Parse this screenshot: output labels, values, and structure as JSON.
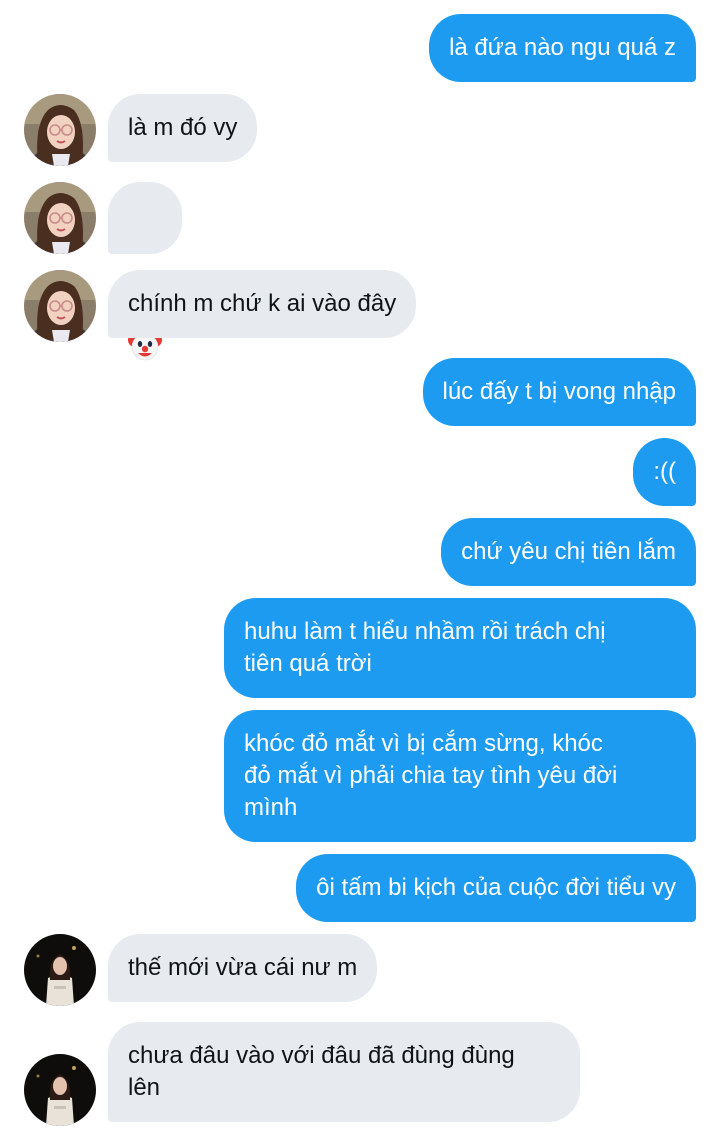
{
  "colors": {
    "outgoing_bubble": "#1d9bf0",
    "incoming_bubble": "#e7ebef",
    "outgoing_text": "#ffffff",
    "incoming_text": "#0f1419"
  },
  "messages": [
    {
      "dir": "out",
      "text": "là đứa nào ngu quá z"
    },
    {
      "dir": "in",
      "text": "là m đó vy",
      "avatar": "girl-glasses-avatar"
    },
    {
      "dir": "in",
      "text": "",
      "emoji": "clown-face-icon",
      "avatar": "girl-glasses-avatar"
    },
    {
      "dir": "in",
      "text": "chính m chứ k ai vào đây",
      "avatar": "girl-glasses-avatar"
    },
    {
      "dir": "out",
      "text": "lúc đấy t bị vong nhập"
    },
    {
      "dir": "out",
      "text": ":(("
    },
    {
      "dir": "out",
      "text": "chứ yêu chị tiên lắm"
    },
    {
      "dir": "out",
      "text": "huhu làm t hiểu nhầm rồi trách chị\ntiên quá trời"
    },
    {
      "dir": "out",
      "text": "khóc đỏ mắt vì bị cắm sừng, khóc\nđỏ mắt vì phải chia tay tình yêu đời\nmình"
    },
    {
      "dir": "out",
      "text": "ôi tấm bi kịch của cuộc đời tiểu vy"
    },
    {
      "dir": "in",
      "text": "thế mới vừa cái nư m",
      "avatar": "girl-night-avatar"
    },
    {
      "dir": "in",
      "text": "chưa đâu vào với đâu đã đùng đùng\nlên",
      "avatar": "girl-night-avatar"
    }
  ]
}
